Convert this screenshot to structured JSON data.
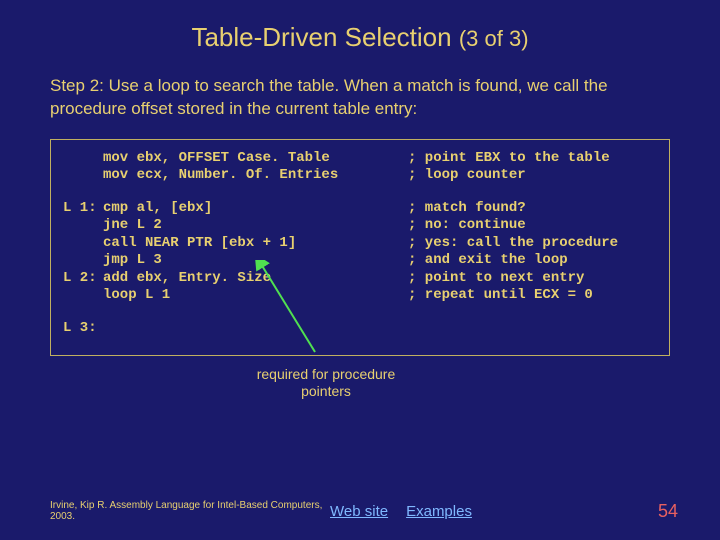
{
  "title": {
    "main": "Table-Driven Selection",
    "sub": "(3 of 3)"
  },
  "step_text": "Step 2: Use a loop to search the table. When a match is found, we call the procedure offset stored in the current table entry:",
  "code": {
    "lines": [
      {
        "label": "",
        "instr": "mov ebx, OFFSET Case. Table",
        "cmt": "; point EBX to the table"
      },
      {
        "label": "",
        "instr": "mov ecx, Number. Of. Entries",
        "cmt": "; loop counter"
      }
    ],
    "lines2": [
      {
        "label": "L 1:",
        "instr": "cmp al, [ebx]",
        "cmt": "; match found?"
      },
      {
        "label": "",
        "instr": "jne L 2",
        "cmt": "; no: continue"
      },
      {
        "label": "",
        "instr": "call NEAR PTR [ebx + 1]",
        "cmt": "; yes: call the procedure"
      },
      {
        "label": "",
        "instr": "jmp L 3",
        "cmt": "; and exit the loop"
      },
      {
        "label": "L 2:",
        "instr": "add ebx, Entry. Size",
        "cmt": "; point to next entry"
      },
      {
        "label": "",
        "instr": "loop L 1",
        "cmt": "; repeat until ECX = 0"
      }
    ],
    "lines3": [
      {
        "label": "L 3:",
        "instr": "",
        "cmt": ""
      }
    ]
  },
  "annotation": {
    "line1": "required for procedure",
    "line2": "pointers"
  },
  "footer": {
    "citation": "Irvine, Kip R. Assembly Language for Intel-Based Computers, 2003.",
    "link_web": "Web site",
    "link_ex": "Examples",
    "page": "54"
  }
}
